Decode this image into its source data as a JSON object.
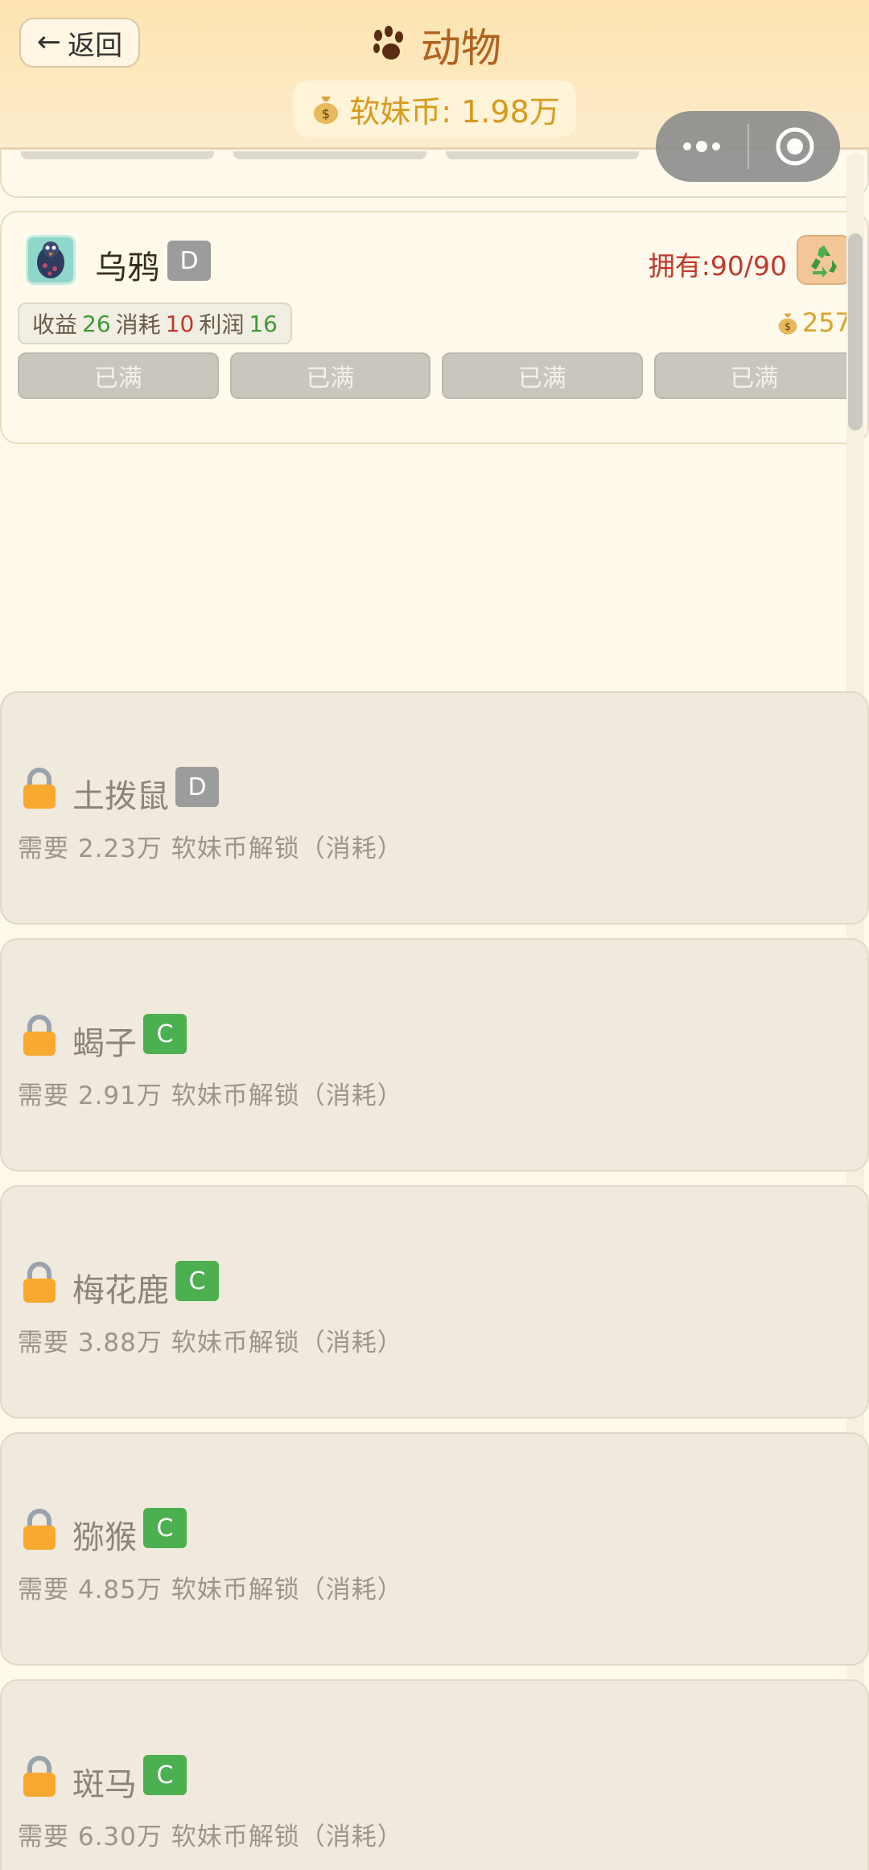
{
  "header": {
    "back_label": "返回",
    "title": "动物",
    "coin_label": "软妹币: 1.98万"
  },
  "animal_card": {
    "name": "乌鸦",
    "grade": "D",
    "owned": "拥有:90/90",
    "stats": {
      "income_label": "收益",
      "income": "26",
      "cost_label": "消耗",
      "cost": "10",
      "profit_label": "利润",
      "profit": "16"
    },
    "price": "257",
    "slots": [
      "已满",
      "已满",
      "已满",
      "已满"
    ]
  },
  "locked_cards": [
    {
      "name": "土拨鼠",
      "grade": "D",
      "requirement": "需要 2.23万 软妹币解锁（消耗）"
    },
    {
      "name": "蝎子",
      "grade": "C",
      "requirement": "需要 2.91万 软妹币解锁（消耗）"
    },
    {
      "name": "梅花鹿",
      "grade": "C",
      "requirement": "需要 3.88万 软妹币解锁（消耗）"
    },
    {
      "name": "猕猴",
      "grade": "C",
      "requirement": "需要 4.85万 软妹币解锁（消耗）"
    },
    {
      "name": "斑马",
      "grade": "C",
      "requirement": "需要 6.30万 软妹币解锁（消耗）"
    }
  ],
  "colors": {
    "grade_d": "#9c9c9c",
    "grade_c": "#4caf50",
    "owned": "#c0392b",
    "coin": "#d69a1c"
  },
  "icons": {
    "title": "paw-icon",
    "coin": "money-bag-icon",
    "recycle": "recycle-icon",
    "locked": "lock-icon",
    "capsule_menu": "more-icon",
    "capsule_close": "target-icon"
  }
}
